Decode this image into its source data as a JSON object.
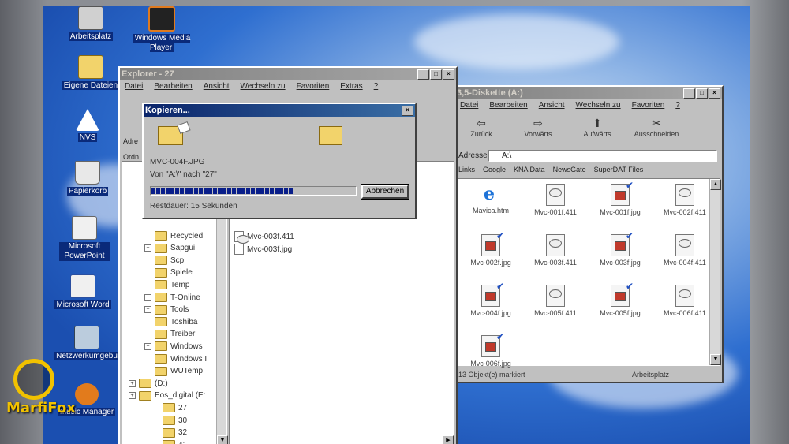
{
  "desktop": {
    "icons": [
      {
        "label": "Arbeitsplatz",
        "icon": "computer-icon"
      },
      {
        "label": "Windows Media Player",
        "icon": "media-player-icon"
      },
      {
        "label": "Eigene Dateien",
        "icon": "my-documents-icon"
      },
      {
        "label": "NVS",
        "icon": "nvs-icon"
      },
      {
        "label": "Papierkorb",
        "icon": "recycle-bin-icon"
      },
      {
        "label": "Microsoft PowerPoint",
        "icon": "powerpoint-icon"
      },
      {
        "label": "Microsoft Word",
        "icon": "word-icon"
      },
      {
        "label": "Netzwerkumgebu",
        "icon": "network-icon"
      },
      {
        "label": "Music Manager",
        "icon": "music-manager-icon"
      }
    ]
  },
  "explorer": {
    "title": "Explorer - 27",
    "menu": [
      "Datei",
      "Bearbeiten",
      "Ansicht",
      "Wechseln zu",
      "Favoriten",
      "Extras",
      "?"
    ],
    "address_label": "Adre",
    "folder_label": "Ordn",
    "tree": [
      "Recycled",
      "Sapgui",
      "Scp",
      "Spiele",
      "Temp",
      "T-Online",
      "Tools",
      "Toshiba",
      "Treiber",
      "Windows",
      "Windows I",
      "WUTemp",
      "(D:)",
      "Eos_digital (E:",
      "27",
      "30",
      "32",
      "41"
    ],
    "files": [
      "Mvc-003f.411",
      "Mvc-003f.jpg"
    ]
  },
  "copy_dialog": {
    "title": "Kopieren...",
    "filename": "MVC-004F.JPG",
    "from_to": "Von \"A:\\\" nach \"27\"",
    "remaining": "Restdauer: 15 Sekunden",
    "cancel_label": "Abbrechen",
    "progress": 0.7
  },
  "floppy": {
    "title": "3,5-Diskette (A:)",
    "menu": [
      "Datei",
      "Bearbeiten",
      "Ansicht",
      "Wechseln zu",
      "Favoriten",
      "?"
    ],
    "toolbar": [
      "Zurück",
      "Vorwärts",
      "Aufwärts",
      "Ausschneiden"
    ],
    "address_label": "Adresse",
    "address_value": "A:\\",
    "links_label": "Links",
    "links": [
      "Google",
      "KNA Data",
      "NewsGate",
      "SuperDAT Files"
    ],
    "files": [
      {
        "name": "Mavica.htm",
        "type": "htm"
      },
      {
        "name": "Mvc-001f.411",
        "type": "txt"
      },
      {
        "name": "Mvc-001f.jpg",
        "type": "jpg"
      },
      {
        "name": "Mvc-002f.411",
        "type": "txt"
      },
      {
        "name": "Mvc-002f.jpg",
        "type": "jpg"
      },
      {
        "name": "Mvc-003f.411",
        "type": "txt"
      },
      {
        "name": "Mvc-003f.jpg",
        "type": "jpg"
      },
      {
        "name": "Mvc-004f.411",
        "type": "txt"
      },
      {
        "name": "Mvc-004f.jpg",
        "type": "jpg"
      },
      {
        "name": "Mvc-005f.411",
        "type": "txt"
      },
      {
        "name": "Mvc-005f.jpg",
        "type": "jpg"
      },
      {
        "name": "Mvc-006f.411",
        "type": "txt"
      },
      {
        "name": "Mvc-006f.jpg",
        "type": "jpg"
      }
    ],
    "status_left": "13 Objekt(e) markiert",
    "status_right": "Arbeitsplatz"
  },
  "watermark": "MarfiFox"
}
